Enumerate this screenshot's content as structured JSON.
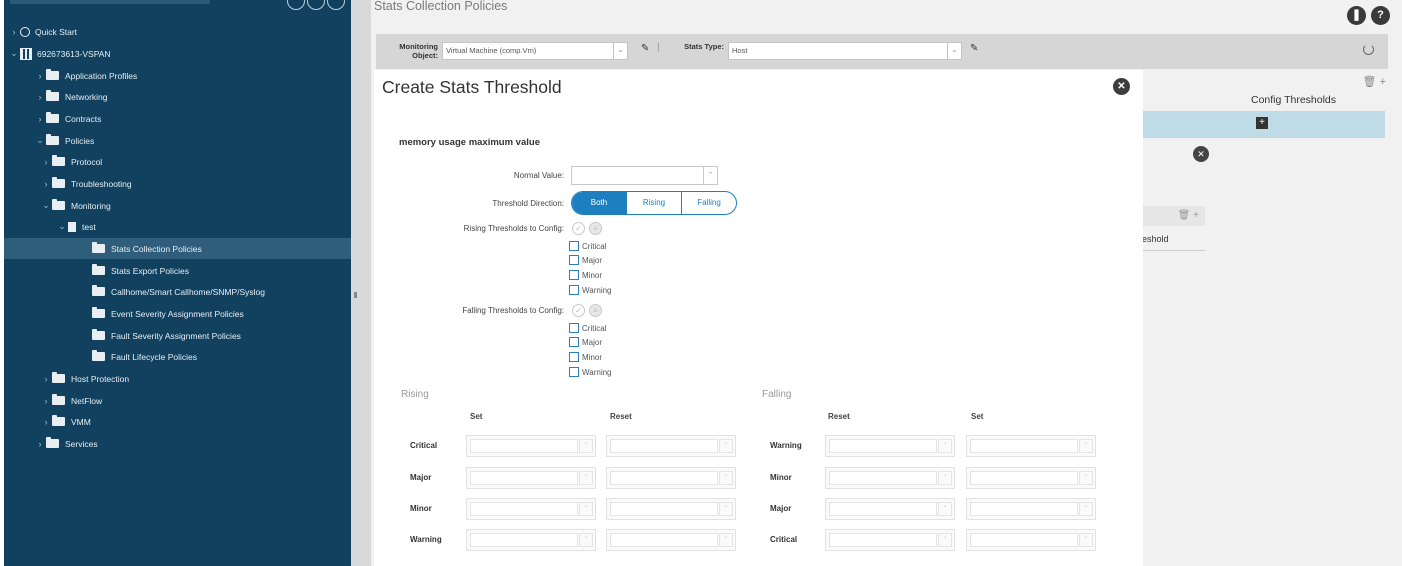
{
  "sidebar": {
    "items": [
      {
        "label": "Quick Start",
        "chev": "›",
        "icon": "quick-start"
      },
      {
        "label": "692673613-VSPAN",
        "chev": "⌄",
        "icon": "tenant"
      },
      {
        "label": "Application Profiles",
        "chev": "›",
        "icon": "folder"
      },
      {
        "label": "Networking",
        "chev": "›",
        "icon": "folder"
      },
      {
        "label": "Contracts",
        "chev": "›",
        "icon": "folder"
      },
      {
        "label": "Policies",
        "chev": "⌄",
        "icon": "folder"
      },
      {
        "label": "Protocol",
        "chev": "›",
        "icon": "folder"
      },
      {
        "label": "Troubleshooting",
        "chev": "›",
        "icon": "folder"
      },
      {
        "label": "Monitoring",
        "chev": "⌄",
        "icon": "folder"
      },
      {
        "label": "test",
        "chev": "⌄",
        "icon": "document"
      },
      {
        "label": "Stats Collection Policies",
        "chev": "",
        "icon": "folder",
        "selected": true
      },
      {
        "label": "Stats Export Policies",
        "chev": "",
        "icon": "folder"
      },
      {
        "label": "Callhome/Smart Callhome/SNMP/Syslog",
        "chev": "",
        "icon": "folder"
      },
      {
        "label": "Event Severity Assignment Policies",
        "chev": "",
        "icon": "folder"
      },
      {
        "label": "Fault Severity Assignment Policies",
        "chev": "",
        "icon": "folder"
      },
      {
        "label": "Fault Lifecycle Policies",
        "chev": "",
        "icon": "folder"
      },
      {
        "label": "Host Protection",
        "chev": "›",
        "icon": "folder"
      },
      {
        "label": "NetFlow",
        "chev": "›",
        "icon": "folder"
      },
      {
        "label": "VMM",
        "chev": "›",
        "icon": "folder"
      },
      {
        "label": "Services",
        "chev": "›",
        "icon": "folder"
      }
    ]
  },
  "main": {
    "page_title": "Stats Collection Policies",
    "monitoring_object_label": "Monitoring Object:",
    "monitoring_object_value": "Virtual Machine (comp.Vm)",
    "stats_type_label": "Stats Type:",
    "stats_type_value": "Host",
    "config_thresholds_header": "Config Thresholds",
    "threshold_partial": "reshold",
    "bg_toolbar": "🗑  +",
    "bg_plus": "+",
    "bg_close": "✕"
  },
  "modal": {
    "title": "Create Stats Threshold",
    "close": "✕",
    "section_title": "memory usage maximum value",
    "normal_value_label": "Normal Value:",
    "threshold_direction_label": "Threshold Direction:",
    "direction_options": [
      "Both",
      "Rising",
      "Falling"
    ],
    "rising_config_label": "Rising Thresholds to Config:",
    "falling_config_label": "Falling Thresholds to Config:",
    "severities": [
      "Critical",
      "Major",
      "Minor",
      "Warning"
    ],
    "rising_grid": {
      "title": "Rising",
      "columns": [
        "Set",
        "Reset"
      ],
      "rows": [
        "Critical",
        "Major",
        "Minor",
        "Warning"
      ]
    },
    "falling_grid": {
      "title": "Falling",
      "columns": [
        "Reset",
        "Set"
      ],
      "rows": [
        "Warning",
        "Minor",
        "Major",
        "Critical"
      ]
    }
  },
  "colors": {
    "sidebar_bg": "#11415f",
    "selected_row": "#2f5e7c",
    "accent_blue": "#1e7fc0",
    "highlight_row": "#bfdbe6"
  }
}
